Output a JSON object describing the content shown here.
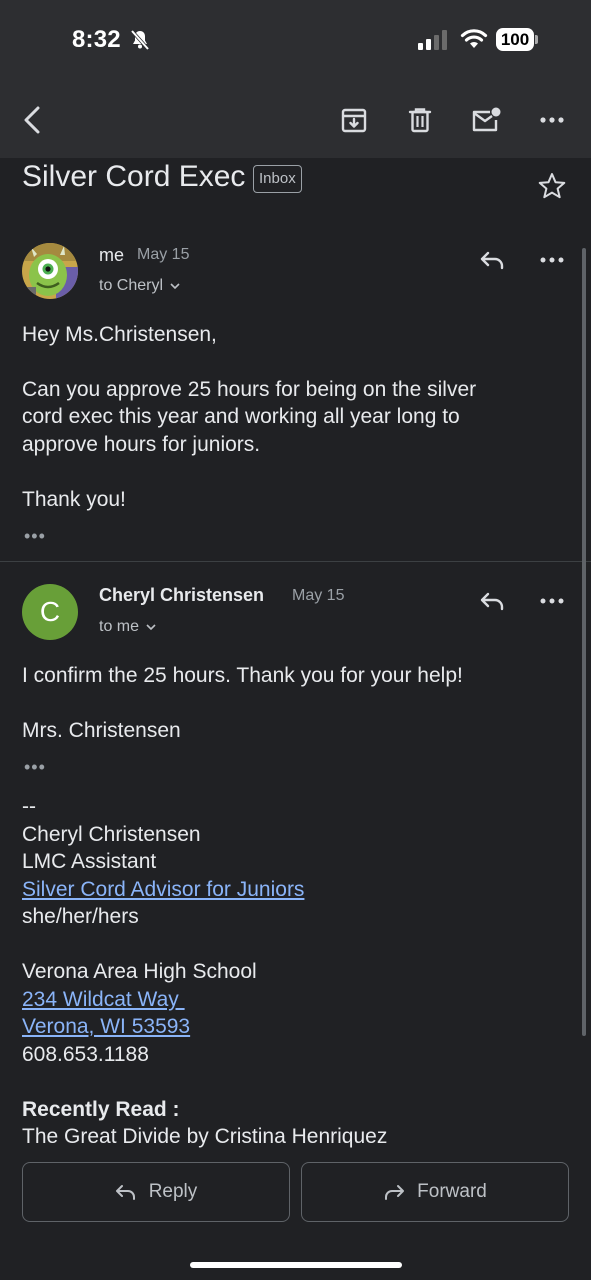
{
  "status_bar": {
    "time": "8:32",
    "battery": "100",
    "icons": [
      "bell-slash-icon",
      "cellular-signal-icon",
      "wifi-icon",
      "battery-icon"
    ]
  },
  "toolbar": {
    "icons": [
      "back-chevron-icon",
      "archive-icon",
      "trash-icon",
      "mark-unread-icon",
      "more-horizontal-icon"
    ]
  },
  "thread": {
    "subject": "Silver Cord Exec",
    "label": "Inbox"
  },
  "messages": [
    {
      "sender": "me",
      "date": "May 15",
      "recipient": "to Cheryl",
      "body": [
        "Hey Ms.Christensen,",
        "Can you approve 25 hours for being on the silver",
        "cord exec this year and working all year long to",
        "approve hours for juniors.",
        "Thank you!"
      ],
      "trimmed": "•••"
    },
    {
      "sender": "Cheryl Christensen",
      "avatar_letter": "C",
      "date": "May 15",
      "recipient": "to me",
      "body": [
        "I confirm the 25 hours.  Thank you for your help!",
        "Mrs. Christensen"
      ],
      "trimmed": "•••",
      "signature": {
        "sep": "--",
        "name": "Cheryl Christensen",
        "role": "LMC Assistant",
        "advisor_link": "Silver Cord Advisor for Juniors",
        "pronouns": "she/her/hers",
        "school": "Verona Area High School",
        "address1": "234 Wildcat Way ",
        "address2": "Verona, WI 53593",
        "phone": "608.653.1188",
        "recently_read_label": "Recently Read :",
        "recently_read": "The Great Divide by Cristina Henriquez"
      }
    }
  ],
  "actions": {
    "reply": "Reply",
    "forward": "Forward"
  },
  "colors": {
    "background": "#202124",
    "toolbar": "#2d2e31",
    "link": "#8ab4f8",
    "avatar_c": "#689f38"
  }
}
